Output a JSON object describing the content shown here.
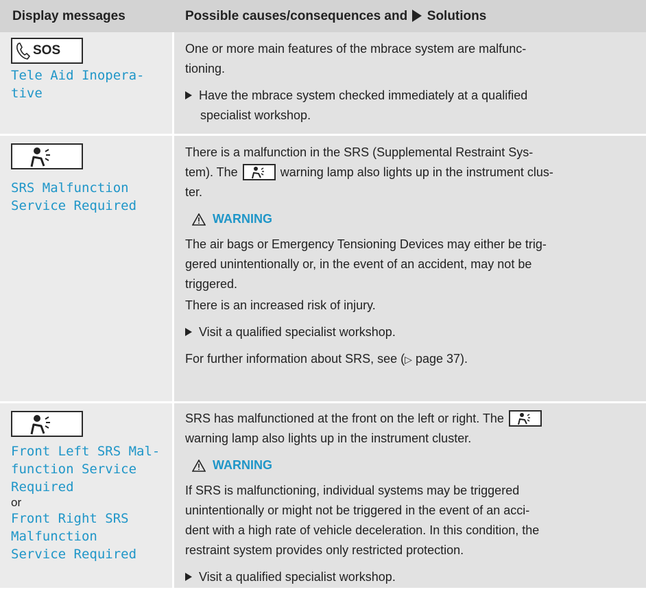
{
  "header": {
    "col1": "Display messages",
    "col2_before": "Possible causes/consequences and",
    "col2_after": "Solutions"
  },
  "rows": [
    {
      "icon": "sos-phone-icon",
      "icon_text": "SOS",
      "display_lines": [
        "Tele Aid Inopera-",
        "tive"
      ],
      "text_lines": [
        "One or more main features of the mbrace system are malfunc-",
        "tioning."
      ],
      "action_lines": [
        "Have the mbrace system checked immediately at a qualified",
        "specialist workshop."
      ]
    },
    {
      "icon": "airbag-warning-icon",
      "display_lines": [
        "SRS Malfunction",
        "Service Required"
      ],
      "text_lines": [
        "There is a malfunction in the SRS (Supplemental Restraint Sys-",
        "tem). The",
        "warning lamp also lights up in the instrument clus-",
        "ter."
      ],
      "warning_label": "WARNING",
      "warning_lines": [
        "The air bags or Emergency Tensioning Devices may either be trig-",
        "gered unintentionally or, in the event of an accident, may not be",
        "triggered."
      ],
      "risk": "There is an increased risk of injury.",
      "action": "Visit a qualified specialist workshop.",
      "info_before": "For further information about SRS, see (",
      "info_after": "page 37)."
    },
    {
      "icon": "airbag-warning-icon",
      "display_lines": [
        "Front Left SRS Mal-",
        "function Service",
        "Required"
      ],
      "or": "or",
      "display_lines_2": [
        "Front Right SRS",
        "Malfunction",
        "Service Required"
      ],
      "text_line1": "SRS has malfunctioned at the front on the left or right. The",
      "text_line2": "warning lamp also lights up in the instrument cluster.",
      "warning_label": "WARNING",
      "warning_lines": [
        "If SRS is malfunctioning, individual systems may be triggered",
        "unintentionally or might not be triggered in the event of an acci-",
        "dent with a high rate of vehicle deceleration. In this condition, the",
        "restraint system provides only restricted protection."
      ],
      "action": "Visit a qualified specialist workshop."
    }
  ],
  "colors": {
    "header_bg": "#d3d3d3",
    "left_bg": "#ebebeb",
    "right_bg": "#e2e2e2",
    "accent": "#1f96c8"
  }
}
